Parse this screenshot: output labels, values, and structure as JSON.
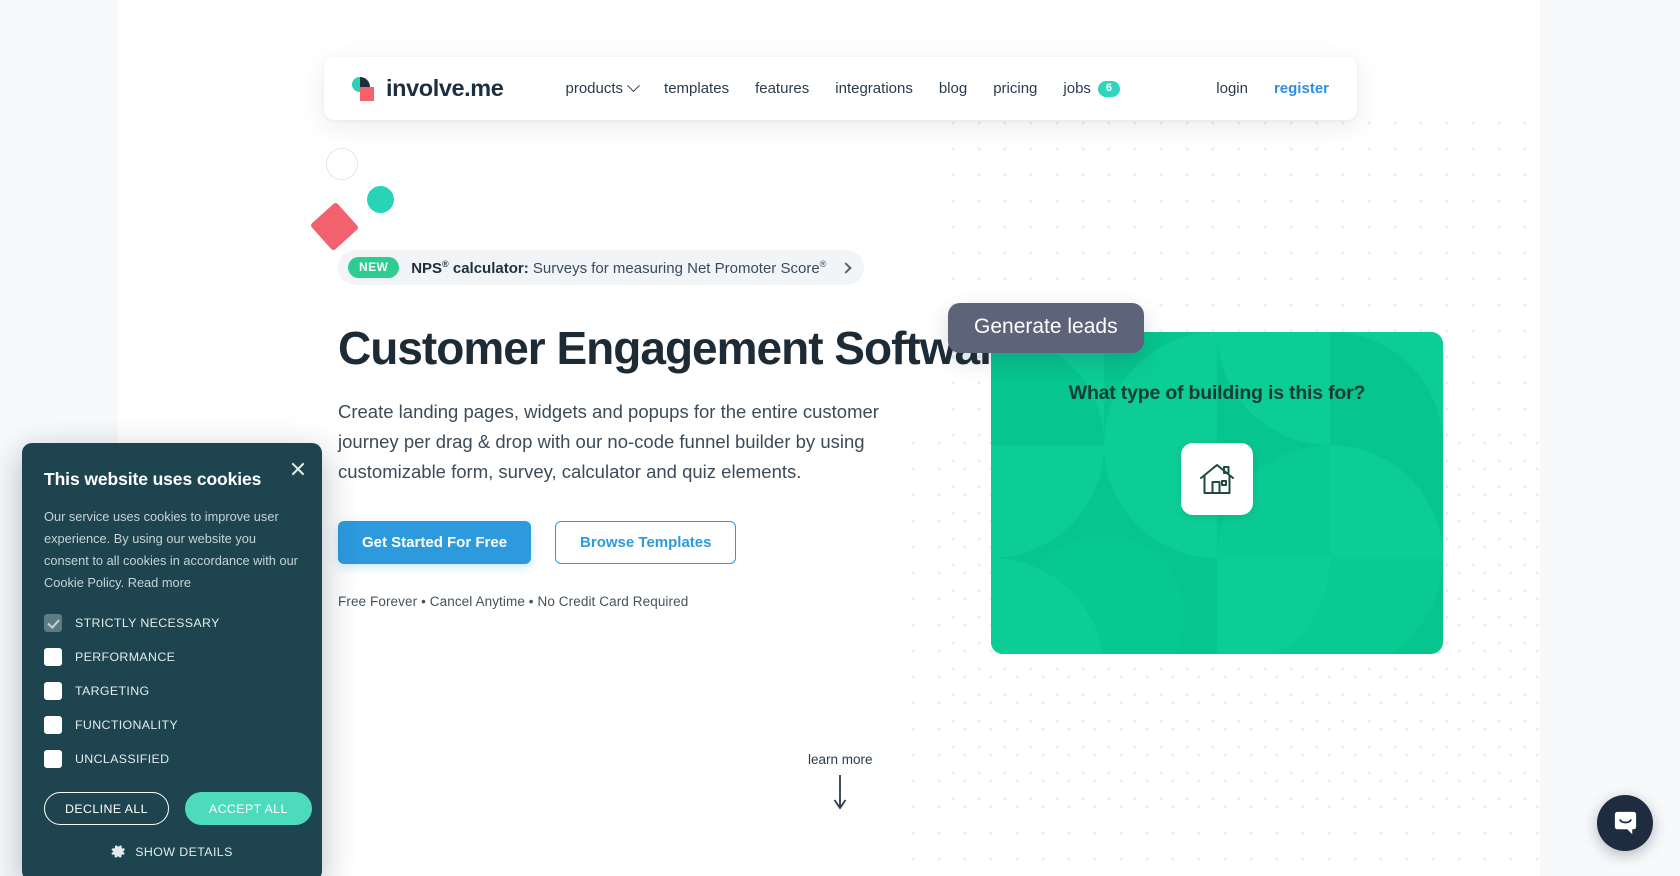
{
  "nav": {
    "logo_text": "involve.me",
    "links": [
      {
        "label": "products",
        "has_chevron": true
      },
      {
        "label": "templates",
        "has_chevron": false
      },
      {
        "label": "features",
        "has_chevron": false
      },
      {
        "label": "integrations",
        "has_chevron": false
      },
      {
        "label": "blog",
        "has_chevron": false
      },
      {
        "label": "pricing",
        "has_chevron": false
      }
    ],
    "jobs_label": "jobs",
    "jobs_badge": "6",
    "login_label": "login",
    "register_label": "register",
    "register_color": "#2d8fe5"
  },
  "announcement": {
    "tag": "NEW",
    "bold_text": "NPS",
    "bold_sup": "®",
    "bold_tail": " calculator:",
    "rest_text": " Surveys for measuring Net Promoter Score",
    "rest_sup": "®",
    "tag_color": "#2ecc90"
  },
  "hero": {
    "title": "Customer Engagement Software",
    "subtitle": "Create landing pages, widgets and popups for the entire customer journey per drag & drop with our no-code funnel builder by using customizable form, survey, calculator and quiz elements.",
    "primary_cta": "Get Started For Free",
    "secondary_cta": "Browse Templates",
    "fineprint": "Free Forever • Cancel Anytime • No Credit Card Required",
    "learn_more": "learn more",
    "primary_color": "#2d9ade"
  },
  "preview_card": {
    "badge": "Generate leads",
    "badge_color": "#5d6378",
    "question": "What type of building is this for?",
    "card_color": "#06c58e",
    "option_icon": "house-icon"
  },
  "cookie_banner": {
    "title": "This website uses cookies",
    "body": "Our service uses cookies to improve user experience. By using our website you consent to all cookies in accordance with our Cookie Policy.",
    "read_more": "Read more",
    "options": [
      {
        "label": "STRICTLY NECESSARY",
        "checked": true
      },
      {
        "label": "PERFORMANCE",
        "checked": false
      },
      {
        "label": "TARGETING",
        "checked": false
      },
      {
        "label": "FUNCTIONALITY",
        "checked": false
      },
      {
        "label": "UNCLASSIFIED",
        "checked": false
      }
    ],
    "decline_label": "DECLINE ALL",
    "accept_label": "ACCEPT ALL",
    "show_details_label": "SHOW DETAILS",
    "accept_color": "#4ddbbd",
    "background_color": "#1e454f"
  },
  "chat_widget": {
    "icon": "intercom-chat-icon",
    "color": "#1f2c3f"
  },
  "decor": {
    "ring_color": "#e4e6e9",
    "teal_dot_color": "#29d3b6",
    "red_square_color": "#f4616e"
  }
}
